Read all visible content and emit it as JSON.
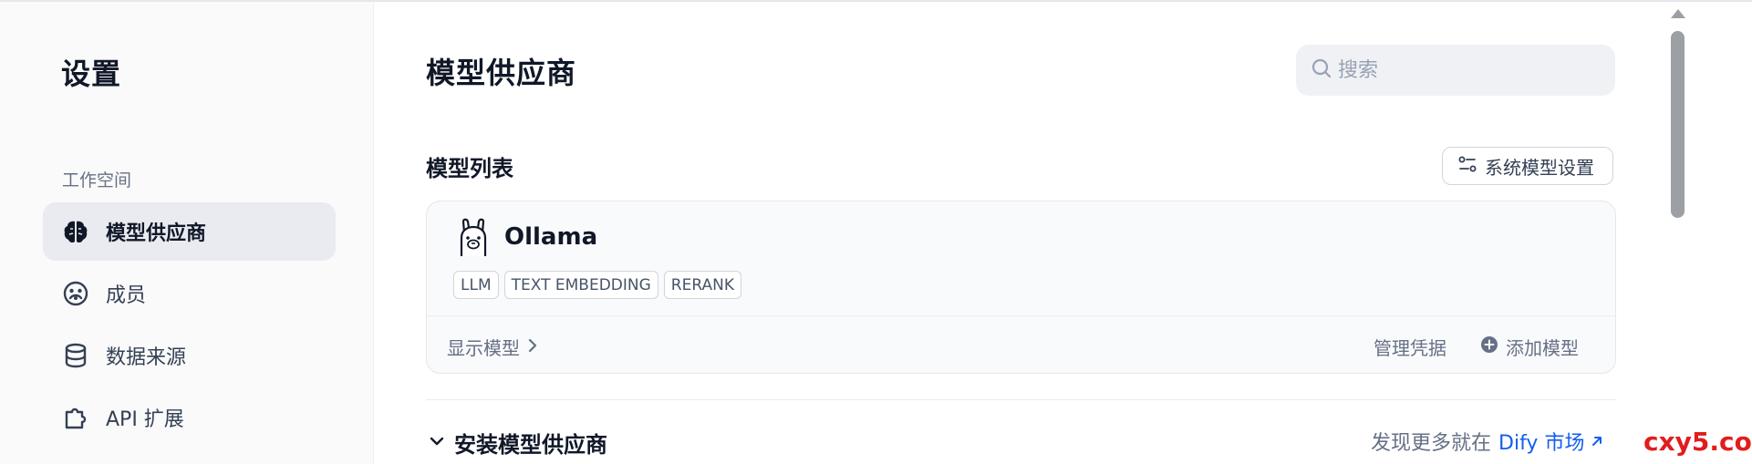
{
  "sidebar": {
    "title": "设置",
    "section": "工作空间",
    "items": [
      {
        "label": "模型供应商",
        "icon": "brain-icon",
        "active": true
      },
      {
        "label": "成员",
        "icon": "members-icon",
        "active": false
      },
      {
        "label": "数据来源",
        "icon": "database-icon",
        "active": false
      },
      {
        "label": "API 扩展",
        "icon": "puzzle-icon",
        "active": false
      }
    ]
  },
  "main": {
    "title": "模型供应商",
    "search": {
      "placeholder": "搜索",
      "value": ""
    },
    "model_list": {
      "title": "模型列表",
      "system_settings_label": "系统模型设置"
    },
    "provider_card": {
      "name": "Ollama",
      "logo": "ollama-llama-icon",
      "tags": [
        "LLM",
        "TEXT EMBEDDING",
        "RERANK"
      ],
      "show_models_label": "显示模型",
      "manage_credentials_label": "管理凭据",
      "add_model_label": "添加模型"
    },
    "install": {
      "title": "安装模型供应商",
      "discover_prefix": "发现更多就在",
      "marketplace_link": "Dify 市场"
    }
  },
  "watermark": "cxy5.com",
  "colors": {
    "accent_link": "#155eef",
    "active_nav_bg": "#e9ebf0",
    "watermark": "#e11d1d"
  }
}
